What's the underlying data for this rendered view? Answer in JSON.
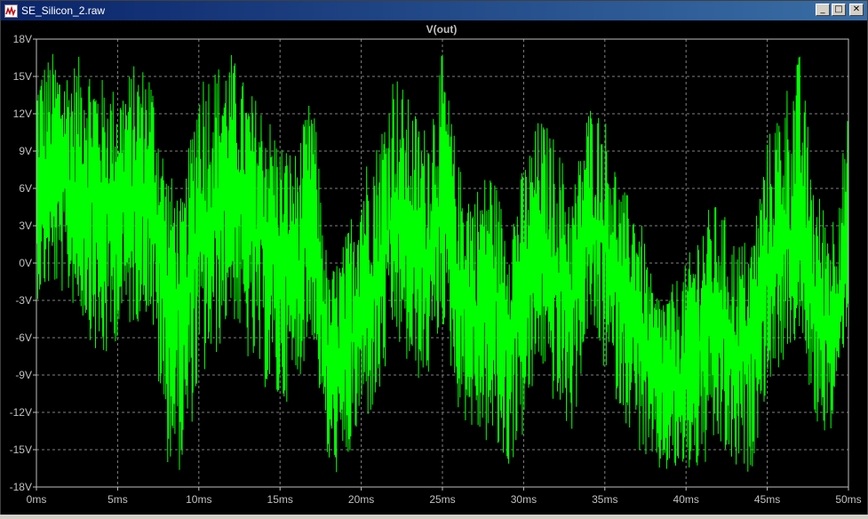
{
  "window": {
    "title": "SE_Silicon_2.raw",
    "min_glyph": "0",
    "max_glyph": "1",
    "close_glyph": "r"
  },
  "colors": {
    "trace": "#00ff00",
    "grid": "#808080",
    "background": "#000000",
    "tick_text": "#c0c0c0"
  },
  "chart_data": {
    "type": "line",
    "title": "V(out)",
    "xlabel": "",
    "ylabel": "",
    "xlim": [
      0,
      50
    ],
    "ylim": [
      -18,
      18
    ],
    "x_ticks": [
      "0ms",
      "5ms",
      "10ms",
      "15ms",
      "20ms",
      "25ms",
      "30ms",
      "35ms",
      "40ms",
      "45ms",
      "50ms"
    ],
    "y_ticks": [
      "18V",
      "15V",
      "12V",
      "9V",
      "6V",
      "3V",
      "0V",
      "-3V",
      "-6V",
      "-9V",
      "-12V",
      "-15V",
      "-18V"
    ],
    "grid": true,
    "series": [
      {
        "name": "V(out)",
        "x": [
          0,
          1,
          2,
          3,
          4,
          5,
          6,
          7,
          8,
          9,
          10,
          11,
          12,
          13,
          14,
          15,
          16,
          17,
          18,
          19,
          20,
          21,
          22,
          23,
          24,
          25,
          26,
          27,
          28,
          29,
          30,
          31,
          32,
          33,
          34,
          35,
          36,
          37,
          38,
          39,
          40,
          41,
          42,
          43,
          44,
          45,
          46,
          47,
          48,
          49,
          50
        ],
        "envelope_center": [
          5,
          7,
          6,
          6,
          4,
          5,
          5,
          6,
          -2,
          -4,
          3,
          4,
          6,
          3,
          2,
          0,
          -1,
          4,
          -9,
          -8,
          -3,
          -1,
          4,
          1,
          0,
          5,
          -2,
          -4,
          -2,
          -5,
          -3,
          1,
          -1,
          -4,
          3,
          2,
          -3,
          -4,
          -10,
          -10,
          -9,
          -6,
          -5,
          -8,
          -7,
          -1,
          1,
          2,
          -5,
          -6,
          2
        ],
        "envelope_min": [
          -3,
          -2,
          -3,
          -5,
          -9,
          -6,
          -5,
          -4,
          -16,
          -17,
          -10,
          -8,
          -4,
          -8,
          -10,
          -12,
          -10,
          -6,
          -17,
          -17,
          -13,
          -12,
          -6,
          -9,
          -10,
          -5,
          -12,
          -14,
          -15,
          -17,
          -14,
          -8,
          -12,
          -14,
          -5,
          -9,
          -12,
          -15,
          -17,
          -17,
          -17,
          -17,
          -15,
          -17,
          -17,
          -10,
          -8,
          -6,
          -13,
          -14,
          -4
        ],
        "envelope_max": [
          16,
          17,
          16,
          17,
          15,
          14,
          16,
          16,
          8,
          5,
          16,
          16,
          17,
          14,
          13,
          10,
          9,
          14,
          -1,
          2,
          8,
          10,
          16,
          13,
          11,
          17,
          8,
          6,
          8,
          3,
          8,
          12,
          10,
          6,
          13,
          12,
          6,
          5,
          -2,
          -2,
          0,
          4,
          5,
          2,
          2,
          10,
          14,
          17,
          6,
          4,
          12
        ]
      }
    ]
  }
}
